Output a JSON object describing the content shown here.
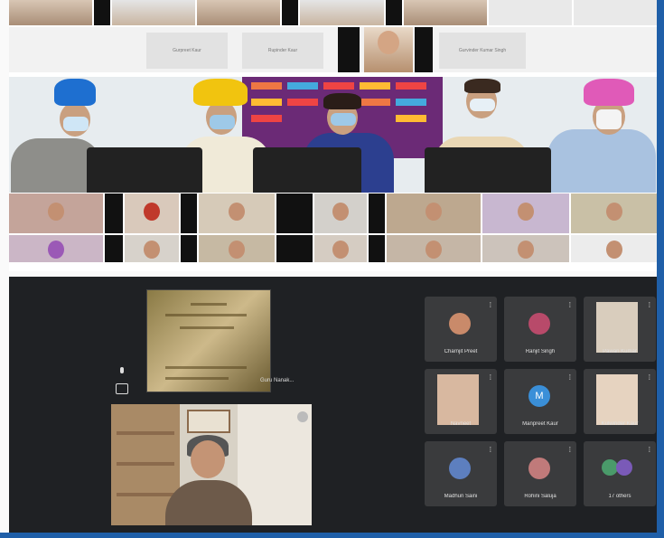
{
  "top_strip": {
    "name_tiles": [
      "Gurpreet Kaur",
      "Rupinder Kaur",
      "Gurvinder Kumar Singh"
    ]
  },
  "meet": {
    "shared_screen_caption": "Guru Nanak...",
    "tiles": [
      {
        "name": "Charnjit Preet",
        "avatar": "photo",
        "color": "#c98a6a"
      },
      {
        "name": "Ranjit Singh",
        "avatar": "flower",
        "color": "#b84a6a"
      },
      {
        "name": "Pawan Kumar",
        "avatar": "photo",
        "color": "#d9cdbd"
      },
      {
        "name": "Navneet",
        "avatar": "photo",
        "color": "#d8b8a0"
      },
      {
        "name": "Manpreet Kaur",
        "avatar": "letter",
        "letter": "M",
        "color": "#3a8fd8"
      },
      {
        "name": "Kulwinder Kaur",
        "avatar": "photo",
        "color": "#e6d3c0"
      },
      {
        "name": "Madhuri Saini",
        "avatar": "photo",
        "color": "#5d7fbf"
      },
      {
        "name": "Rohini Saluja",
        "avatar": "photo",
        "color": "#c07a7a"
      },
      {
        "name": "17 others",
        "avatar": "group",
        "color": "#4a9a6a"
      }
    ]
  }
}
